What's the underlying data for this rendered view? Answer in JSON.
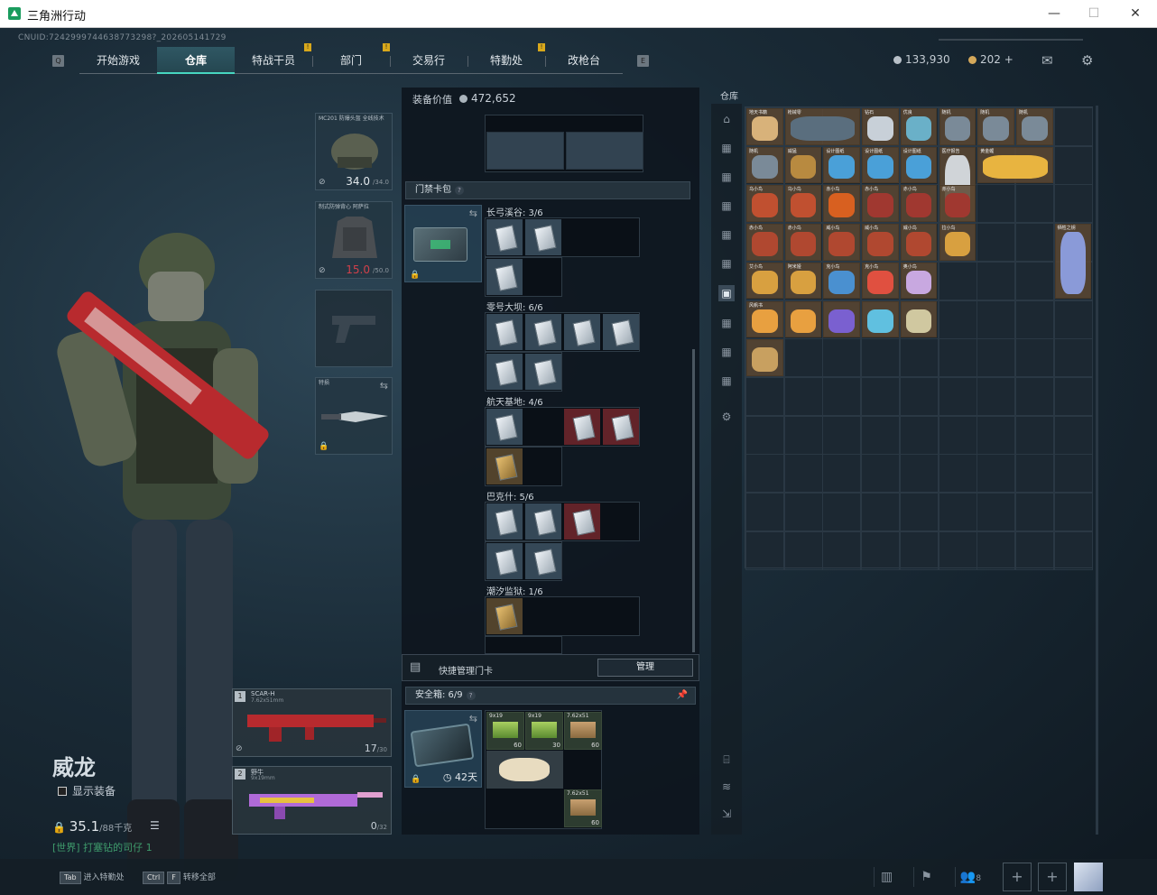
{
  "window": {
    "title": "三角洲行动"
  },
  "uid": "CNUID:7242999744638773298?_202605141729",
  "nav": {
    "tabs": [
      "开始游戏",
      "仓库",
      "特战干员",
      "部门",
      "交易行",
      "特勤处",
      "改枪台"
    ],
    "active": 1,
    "badges": [
      "!",
      "!",
      "!"
    ]
  },
  "currency": {
    "coins": "133,930",
    "tokens": "202 +"
  },
  "operator": {
    "name": "威龙",
    "show_equip": "显示装备",
    "weight": "35.1",
    "weight_max": "/88千克",
    "world": "[世界] 打塞钻的司仔 1"
  },
  "equipment": {
    "helmet": {
      "label": "MC201 防爆头盔 全线技术",
      "value": "34.0",
      "max": "/34.0"
    },
    "armor": {
      "label": "制式防弹背心 阿萨拉",
      "value": "15.0",
      "max": "/50.0"
    },
    "pistol": {
      "label": ""
    },
    "melee": {
      "label": "特损"
    }
  },
  "weapons": [
    {
      "num": "1",
      "name": "SCAR-H",
      "cal": "7.62x51mm",
      "ammo": "17",
      "max": "/30"
    },
    {
      "num": "2",
      "name": "野牛",
      "cal": "9x19mm",
      "ammo": "0",
      "max": "/32"
    }
  ],
  "middle": {
    "equip_value_label": "装备价值",
    "equip_value": "472,652",
    "keycard_header": "门禁卡包",
    "groups": [
      {
        "name": "长弓溪谷: 3/6"
      },
      {
        "name": "零号大坝: 6/6"
      },
      {
        "name": "航天基地: 4/6"
      },
      {
        "name": "巴克什: 5/6"
      },
      {
        "name": "潮汐监狱: 1/6"
      }
    ],
    "quick_manage": "快捷管理门卡",
    "manage_btn": "管理",
    "safe_label": "安全箱: 6/9",
    "safe_days": "42天",
    "ammo": [
      {
        "name": "9x19",
        "count": "60"
      },
      {
        "name": "9x19",
        "count": "30"
      },
      {
        "name": "7.62x51",
        "count": "60"
      },
      {
        "name": "7.62x51",
        "count": "60"
      }
    ]
  },
  "warehouse": {
    "title": "仓库",
    "items": [
      "地天书籍",
      "枪械零",
      "钻石",
      "优良",
      "随机",
      "随机",
      "随机",
      "随机",
      "威猛",
      "设计图纸",
      "设计图纸",
      "设计图纸",
      "医疗报告",
      "黄金鲤",
      "乌小鸟",
      "乌小鸟",
      "赤小鸟",
      "赤小鸟",
      "赤小鸟",
      "赤小鸟",
      "赤小鸟",
      "赤小鸟",
      "威小鸟",
      "威小鸟",
      "威小鸟",
      "拉小鸟",
      "艾小鸟",
      "阿米娅",
      "克小鸟",
      "克小鸟",
      "奥小鸟",
      "牺牲之钥",
      "风帆书"
    ]
  },
  "bottom": {
    "tab_key": "Tab",
    "tab_label": "进入特勤处",
    "ctrl_key": "Ctrl",
    "f_key": "F",
    "transfer_label": "转移全部",
    "players": "8"
  }
}
